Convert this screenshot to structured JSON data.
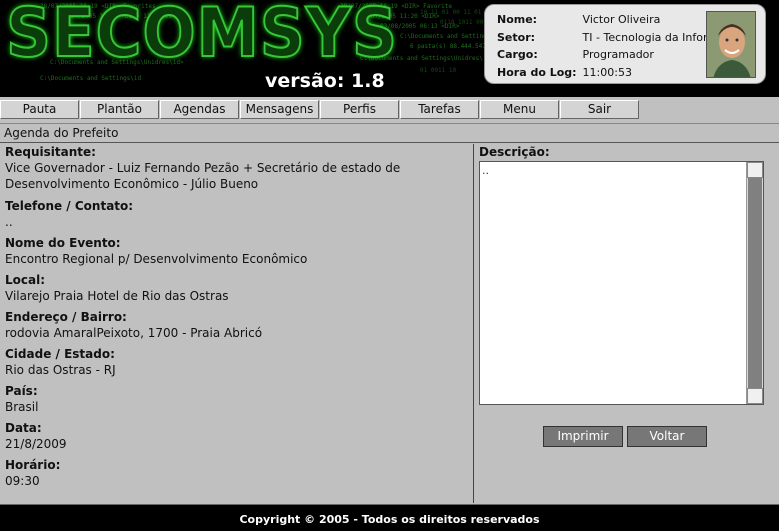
{
  "header": {
    "logo_text": "SECOMSYS",
    "version": "versão: 1.8"
  },
  "user": {
    "nome_label": "Nome:",
    "nome": "Victor Oliveira",
    "setor_label": "Setor:",
    "setor": "TI - Tecnologia da Informação",
    "cargo_label": "Cargo:",
    "cargo": "Programador",
    "hora_label": "Hora do Log:",
    "hora": "11:00:53"
  },
  "menu": [
    "Pauta",
    "Plantão",
    "Agendas",
    "Mensagens",
    "Perfis",
    "Tarefas",
    "Menu",
    "Sair"
  ],
  "page_title": "Agenda do Prefeito",
  "fields": {
    "requisitante_label": "Requisitante:",
    "requisitante_l1": "Vice Governador - Luiz Fernando Pezão + Secretário de estado de",
    "requisitante_l2": "Desenvolvimento Econômico - Júlio Bueno",
    "telefone_label": "Telefone / Contato:",
    "telefone": "..",
    "evento_label": "Nome do Evento:",
    "evento": "Encontro Regional p/ Desenvolvimento Econômico",
    "local_label": "Local:",
    "local": "Vilarejo Praia Hotel de Rio das Ostras",
    "endereco_label": "Endereço / Bairro:",
    "endereco": "rodovia AmaralPeixoto, 1700 - Praia Abricó",
    "cidade_label": "Cidade / Estado:",
    "cidade": "Rio das Ostras - RJ",
    "pais_label": "País:",
    "pais": "Brasil",
    "data_label": "Data:",
    "data": "21/8/2009",
    "horario_label": "Horário:",
    "horario": "09:30"
  },
  "descricao": {
    "label": "Descrição:",
    "value": ".."
  },
  "buttons": {
    "imprimir": "Imprimir",
    "voltar": "Voltar"
  },
  "footer": "Copyright © 2005 - Todos os direitos reservados"
}
